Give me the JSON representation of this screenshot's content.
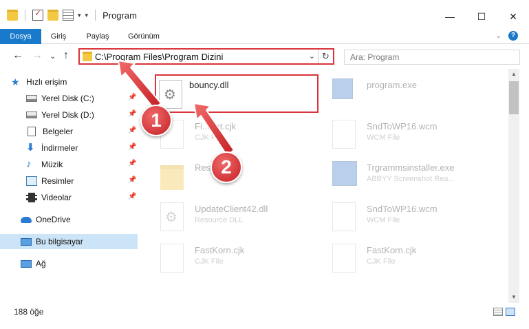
{
  "window": {
    "title": "Program",
    "controls": {
      "minimize": "—",
      "maximize": "☐",
      "close": "✕"
    }
  },
  "ribbon": {
    "tabs": [
      "Dosya",
      "Giriş",
      "Paylaş",
      "Görünüm"
    ]
  },
  "nav": {
    "back": "←",
    "forward": "→",
    "recent": "⌄",
    "up": "↑",
    "address": "C:\\Program Files\\Program Dizini",
    "search_placeholder": "Ara: Program"
  },
  "sidebar": {
    "items": [
      {
        "label": "Hızlı erişim",
        "icon": "star-icon"
      },
      {
        "label": "Yerel Disk (C:)",
        "icon": "drive-icon"
      },
      {
        "label": "Yerel Disk (D:)",
        "icon": "drive-icon"
      },
      {
        "label": "Belgeler",
        "icon": "document-icon"
      },
      {
        "label": "İndirmeler",
        "icon": "download-icon"
      },
      {
        "label": "Müzik",
        "icon": "music-icon"
      },
      {
        "label": "Resimler",
        "icon": "picture-icon"
      },
      {
        "label": "Videolar",
        "icon": "video-icon"
      },
      {
        "label": "OneDrive",
        "icon": "cloud-icon"
      },
      {
        "label": "Bu bilgisayar",
        "icon": "computer-icon"
      },
      {
        "label": "Ağ",
        "icon": "network-icon"
      }
    ]
  },
  "files": [
    {
      "name": "bouncy.dll",
      "type": ""
    },
    {
      "name": "program.exe",
      "type": ""
    },
    {
      "name": "Fi...rmt.cjk",
      "type": "CJK File"
    },
    {
      "name": "SndToWP16.wcm",
      "type": "WCM File"
    },
    {
      "name": "Resou...",
      "type": ""
    },
    {
      "name": "Trgrammsinstaller.exe",
      "type": "ABBYY Screenshot Rea..."
    },
    {
      "name": "UpdateClient42.dll",
      "type": "Resource DLL"
    },
    {
      "name": "SndToWP16.wcm",
      "type": "WCM File"
    },
    {
      "name": "FastKorn.cjk",
      "type": "CJK File"
    },
    {
      "name": "FastKorn.cjk",
      "type": "CJK File"
    }
  ],
  "status": {
    "item_count": "188 öğe"
  },
  "annotations": {
    "badge1": "1",
    "badge2": "2",
    "color": "#d9343a"
  }
}
